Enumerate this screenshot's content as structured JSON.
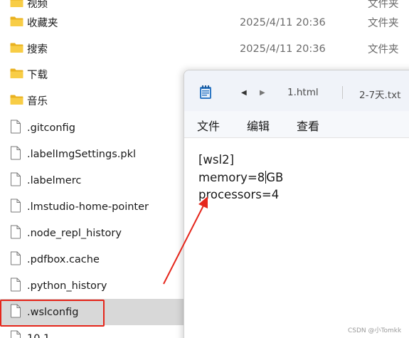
{
  "explorer": {
    "rows": [
      {
        "name": "视频",
        "date": "",
        "type": "文件夹",
        "kind": "folder"
      },
      {
        "name": "收藏夹",
        "date": "2025/4/11 20:36",
        "type": "文件夹",
        "kind": "folder"
      },
      {
        "name": "搜索",
        "date": "2025/4/11 20:36",
        "type": "文件夹",
        "kind": "folder"
      },
      {
        "name": "下载",
        "date": "",
        "type": "",
        "kind": "folder"
      },
      {
        "name": "音乐",
        "date": "",
        "type": "",
        "kind": "folder"
      },
      {
        "name": ".gitconfig",
        "date": "",
        "type": "",
        "kind": "file"
      },
      {
        "name": ".labelImgSettings.pkl",
        "date": "",
        "type": "",
        "kind": "file"
      },
      {
        "name": ".labelmerc",
        "date": "",
        "type": "",
        "kind": "file"
      },
      {
        "name": ".lmstudio-home-pointer",
        "date": "",
        "type": "",
        "kind": "file"
      },
      {
        "name": ".node_repl_history",
        "date": "",
        "type": "",
        "kind": "file"
      },
      {
        "name": ".pdfbox.cache",
        "date": "",
        "type": "",
        "kind": "file"
      },
      {
        "name": ".python_history",
        "date": "",
        "type": "",
        "kind": "file"
      },
      {
        "name": ".wslconfig",
        "date": "",
        "type": "",
        "kind": "file",
        "selected": true
      },
      {
        "name": "10.1",
        "date": "",
        "type": "",
        "kind": "file"
      }
    ]
  },
  "notepad": {
    "nav_back": "◀",
    "nav_forward": "▶",
    "tab1": "1.html",
    "tab2": "2-7天.txt",
    "menu": {
      "file": "文件",
      "edit": "编辑",
      "view": "查看"
    },
    "content": {
      "line1": "[wsl2]",
      "line2_before": "memory=8",
      "line2_after": "GB",
      "line3": "processors=4"
    }
  },
  "watermark": "CSDN @小Tomkk",
  "colors": {
    "highlight": "#e5261b",
    "folder": "#f4c430",
    "selected_row": "#d8d8d8"
  }
}
